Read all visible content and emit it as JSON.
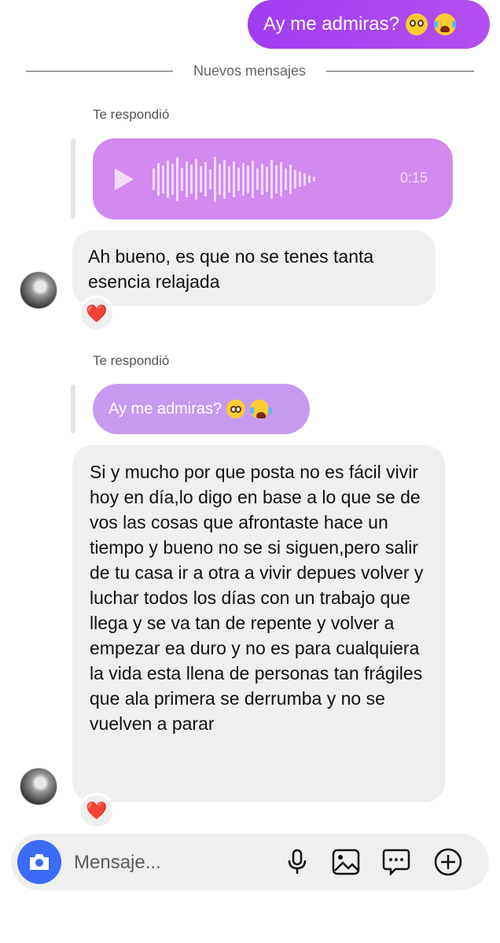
{
  "thread": {
    "outgoing_message": {
      "text": "Ay me admiras?",
      "emojis": [
        "pleading-face",
        "loudly-crying-face"
      ]
    },
    "divider_label": "Nuevos mensajes",
    "reply_label_1": "Te respondió",
    "audio": {
      "duration": "0:15"
    },
    "message_1": {
      "text": "Ah bueno, es que no se tenes tanta esencia relajada",
      "reaction": "❤️"
    },
    "reply_label_2": "Te respondió",
    "quoted": {
      "text": "Ay me admiras?",
      "emojis": [
        "pleading-face",
        "loudly-crying-face"
      ]
    },
    "message_2": {
      "text": "Si y mucho por que posta no es fácil vivir hoy en día,lo digo en base a lo que se de vos las cosas que afrontaste hace un tiempo y bueno no se si siguen,pero salir de tu casa ir a otra a vivir depues volver y luchar todos los días con un trabajo que llega y se va tan de repente y volver a empezar ea duro y no es para cualquiera la vida esta llena de personas tan frágiles que ala primera se derrumba y no se vuelven a parar",
      "reaction": "❤️"
    }
  },
  "composer": {
    "placeholder": "Mensaje...",
    "icons": [
      "camera-icon",
      "microphone-icon",
      "gallery-icon",
      "sticker-icon",
      "add-icon"
    ]
  },
  "colors": {
    "outgoing": "#a23cf0",
    "audio_bubble": "#d08af0",
    "quote_bubble": "#c79af2",
    "incoming": "#efefef",
    "camera_button": "#3b6cf6"
  }
}
